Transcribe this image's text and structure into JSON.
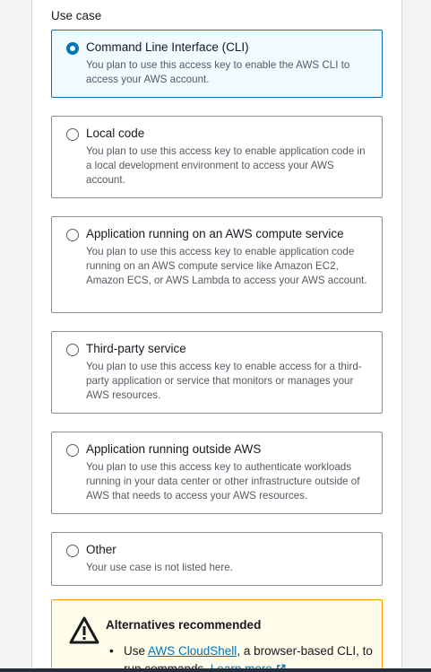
{
  "section_label": "Use case",
  "options": [
    {
      "title": "Command Line Interface (CLI)",
      "description": "You plan to use this access key to enable the AWS CLI to access your AWS account.",
      "selected": true
    },
    {
      "title": "Local code",
      "description": "You plan to use this access key to enable application code in a local development environment to access your AWS account.",
      "selected": false
    },
    {
      "title": "Application running on an AWS compute service",
      "description": "You plan to use this access key to enable application code running on an AWS compute service like Amazon EC2, Amazon ECS, or AWS Lambda to access your AWS account.",
      "selected": false
    },
    {
      "title": "Third-party service",
      "description": "You plan to use this access key to enable access for a third-party application or service that monitors or manages your AWS resources.",
      "selected": false
    },
    {
      "title": "Application running outside AWS",
      "description": "You plan to use this access key to authenticate workloads running in your data center or other infrastructure outside of AWS that needs to access your AWS resources.",
      "selected": false
    },
    {
      "title": "Other",
      "description": "Your use case is not listed here.",
      "selected": false
    }
  ],
  "alert": {
    "title": "Alternatives recommended",
    "icon": "warning-icon",
    "item_prefix": "Use ",
    "item_link": "AWS CloudShell",
    "item_middle": ", a browser-based CLI, to run commands. ",
    "item_learn_more": "Learn more"
  },
  "colors": {
    "accent": "#0073bb",
    "selected_bg": "#f1faff",
    "warning_border": "#ff9900",
    "warning_bg": "#fffce9"
  }
}
